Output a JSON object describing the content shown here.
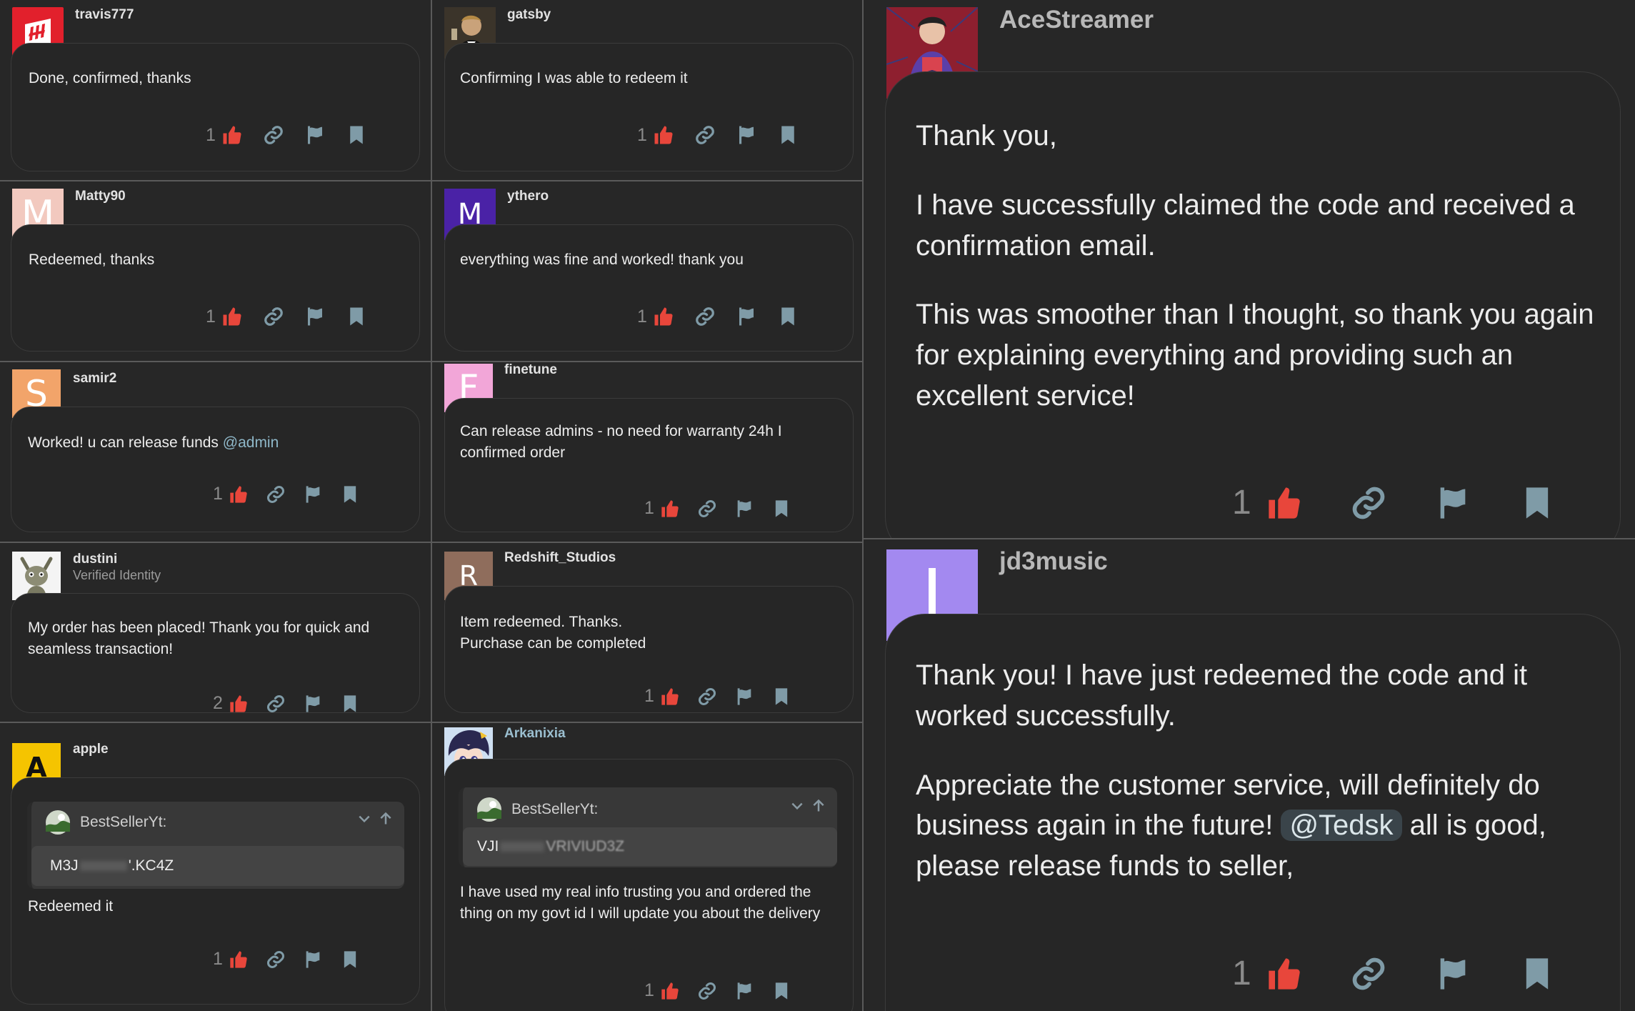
{
  "posts": [
    {
      "user": "travis777",
      "text": "Done, confirmed, thanks",
      "likes": "1"
    },
    {
      "user": "gatsby",
      "text": "Confirming I was able to redeem it",
      "likes": "1"
    },
    {
      "user": "Matty90",
      "avatar_letter": "M",
      "text": "Redeemed, thanks",
      "likes": "1"
    },
    {
      "user": "ythero",
      "avatar_letter": "M",
      "text": "everything was fine and worked! thank you",
      "likes": "1"
    },
    {
      "user": "samir2",
      "avatar_letter": "S",
      "text": "Worked! u can release funds ",
      "mention": "@admin",
      "likes": "1"
    },
    {
      "user": "finetune",
      "avatar_letter": "F",
      "text": "Can release admins - no need for warranty 24h I confirmed order",
      "likes": "1"
    },
    {
      "user": "dustini",
      "subtitle": "Verified Identity",
      "text": "My order has been placed! Thank you for quick and seamless transaction!",
      "likes": "2"
    },
    {
      "user": "Redshift_Studios",
      "avatar_letter": "R",
      "text1": "Item redeemed. Thanks.",
      "text2": "Purchase can be completed",
      "likes": "1"
    },
    {
      "user": "apple",
      "avatar_letter": "A",
      "quote_author": "BestSellerYt:",
      "quote_code_start": "M3J",
      "quote_code_end": "'.KC4Z",
      "text": "Redeemed it",
      "likes": "1"
    },
    {
      "user": "Arkanixia",
      "quote_author": "BestSellerYt:",
      "quote_code_start": "VJI",
      "quote_code_end": "VRIVIUD3Z",
      "text": "I have used my real info trusting you and ordered the thing on my govt id I will update you about the delivery",
      "likes": "1"
    },
    {
      "user": "AceStreamer",
      "p1": "Thank you,",
      "p2": "I have successfully claimed the code and received a confirmation email.",
      "p3": "This was smoother than I thought, so thank you again for explaining everything and providing such an excellent service!",
      "likes": "1"
    },
    {
      "user": "jd3music",
      "avatar_letter": "J",
      "p1": "Thank you! I have just redeemed the code and it worked successfully.",
      "p2a": "Appreciate the customer service, will definitely do business again in the future! ",
      "mention": "@Tedsk",
      "p2b": " all is good, please release funds to seller,",
      "likes": "1"
    }
  ],
  "icons": {
    "like": "thumbs-up-icon",
    "link": "link-icon",
    "flag": "flag-icon",
    "bookmark": "bookmark-icon"
  },
  "colors": {
    "like": "#e8463b",
    "muted_icon": "#7f9ba7",
    "background": "#272727"
  }
}
